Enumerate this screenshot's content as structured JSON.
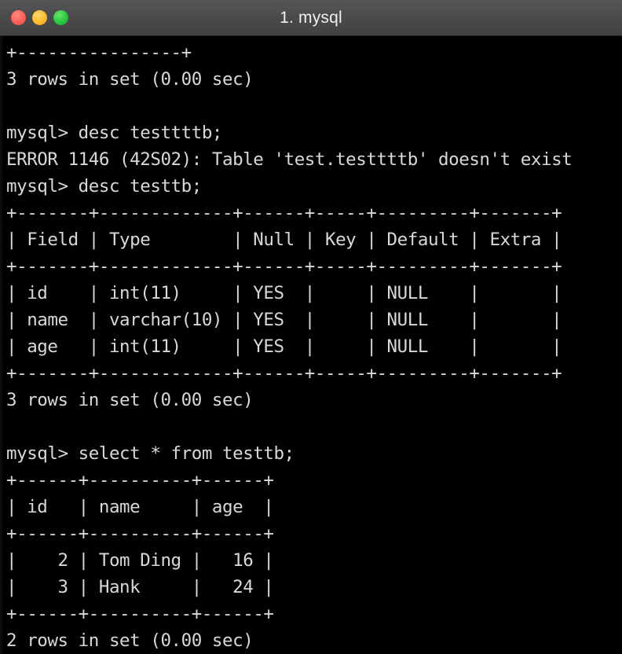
{
  "window": {
    "title": "1. mysql",
    "controls": [
      {
        "name": "close",
        "label": "Close",
        "color": "#ff5f57"
      },
      {
        "name": "minimize",
        "label": "Minimize",
        "color": "#febc2e"
      },
      {
        "name": "zoom",
        "label": "Zoom",
        "color": "#28c840"
      }
    ],
    "titlebar_color": "#4a4a4a"
  },
  "terminal": {
    "background_color": "#000000",
    "foreground_color": "#d8d8d8",
    "prompt": "mysql>",
    "lines": [
      "+----------------+",
      "3 rows in set (0.00 sec)",
      "",
      "mysql> desc testtttb;",
      "ERROR 1146 (42S02): Table 'test.testtttb' doesn't exist",
      "mysql> desc testtb;",
      "+-------+-------------+------+-----+---------+-------+",
      "| Field | Type        | Null | Key | Default | Extra |",
      "+-------+-------------+------+-----+---------+-------+",
      "| id    | int(11)     | YES  |     | NULL    |       |",
      "| name  | varchar(10) | YES  |     | NULL    |       |",
      "| age   | int(11)     | YES  |     | NULL    |       |",
      "+-------+-------------+------+-----+---------+-------+",
      "3 rows in set (0.00 sec)",
      "",
      "mysql> select * from testtb;",
      "+------+----------+------+",
      "| id   | name     | age  |",
      "+------+----------+------+",
      "|    2 | Tom Ding |   16 |",
      "|    3 | Hank     |   24 |",
      "+------+----------+------+",
      "2 rows in set (0.00 sec)"
    ],
    "commands": [
      "desc testtttb;",
      "desc testtb;",
      "select * from testtb;"
    ],
    "errors": [
      "ERROR 1146 (42S02): Table 'test.testtttb' doesn't exist"
    ],
    "status_lines": [
      "3 rows in set (0.00 sec)",
      "3 rows in set (0.00 sec)",
      "2 rows in set (0.00 sec)"
    ],
    "describe_table": {
      "table_name": "testtb",
      "columns": [
        "Field",
        "Type",
        "Null",
        "Key",
        "Default",
        "Extra"
      ],
      "rows": [
        [
          "id",
          "int(11)",
          "YES",
          "",
          "NULL",
          ""
        ],
        [
          "name",
          "varchar(10)",
          "YES",
          "",
          "NULL",
          ""
        ],
        [
          "age",
          "int(11)",
          "YES",
          "",
          "NULL",
          ""
        ]
      ],
      "row_count_text": "3 rows in set (0.00 sec)"
    },
    "select_table": {
      "table_name": "testtb",
      "columns": [
        "id",
        "name",
        "age"
      ],
      "rows": [
        [
          "2",
          "Tom Ding",
          "16"
        ],
        [
          "3",
          "Hank",
          "24"
        ]
      ],
      "row_count_text": "2 rows in set (0.00 sec)"
    }
  }
}
